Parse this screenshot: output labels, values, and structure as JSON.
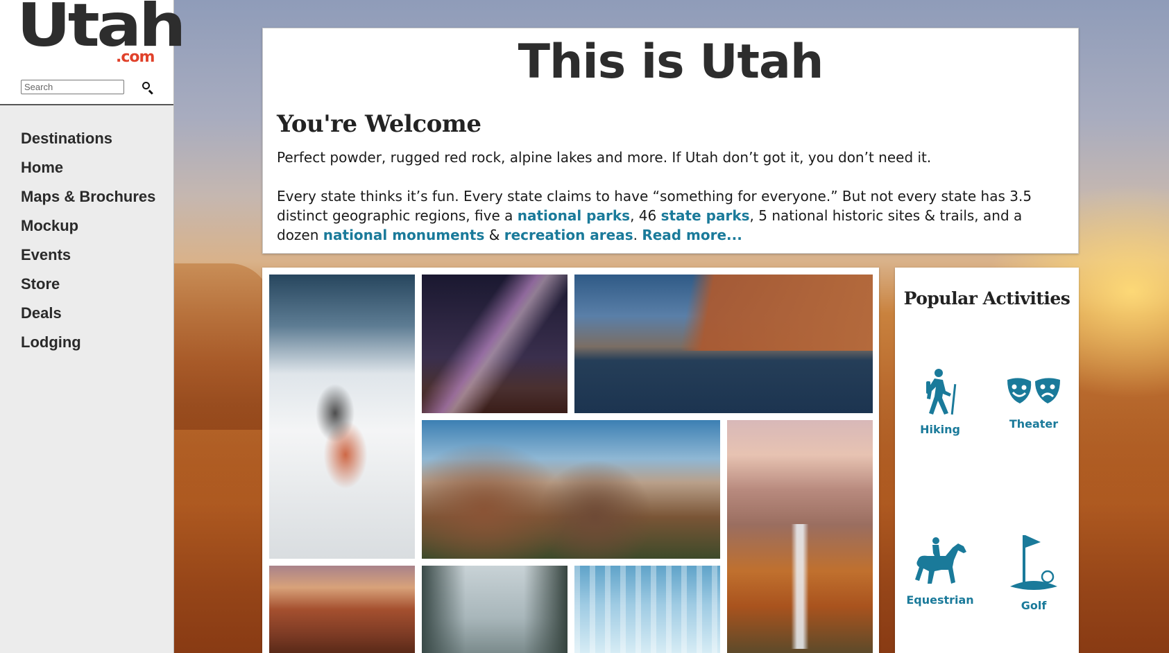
{
  "brand": {
    "logo_main": "Utah",
    "logo_suffix": ".com"
  },
  "search": {
    "placeholder": "Search"
  },
  "nav": {
    "items": [
      {
        "label": "Destinations"
      },
      {
        "label": "Home"
      },
      {
        "label": "Maps & Brochures"
      },
      {
        "label": "Mockup"
      },
      {
        "label": "Events"
      },
      {
        "label": "Store"
      },
      {
        "label": "Deals"
      },
      {
        "label": "Lodging"
      }
    ]
  },
  "intro": {
    "title": "This is Utah",
    "subtitle": "You're Welcome",
    "paragraph1": "Perfect powder, rugged red rock, alpine lakes and more. If Utah don’t got it, you don’t need it.",
    "p2_text1": "Every state thinks it’s fun. Every state claims to have “something for everyone.” But not every state has 3.5 distinct geographic regions, five a ",
    "p2_link1": "national parks",
    "p2_text2": ", 46 ",
    "p2_link2": "state parks",
    "p2_text3": ", 5 national historic sites & trails, and a dozen ",
    "p2_link3": "national monuments",
    "p2_text4": " & ",
    "p2_link4": "recreation areas",
    "p2_text5": ". ",
    "read_more": "Read more..."
  },
  "gallery": {
    "photos": [
      "skier",
      "milky-way-arch",
      "river-canyon",
      "zion-peaks",
      "waterfall",
      "red-canyon-lake",
      "misty-forest",
      "ice-formation"
    ]
  },
  "activities": {
    "title": "Popular Activities",
    "items": [
      {
        "label": "Hiking",
        "icon": "hiking-icon"
      },
      {
        "label": "Theater",
        "icon": "theater-masks-icon"
      },
      {
        "label": "Equestrian",
        "icon": "horse-rider-icon"
      },
      {
        "label": "Golf",
        "icon": "golf-flag-icon"
      }
    ]
  },
  "colors": {
    "accent": "#1a7a9a",
    "logo_red": "#e0412a",
    "text_dark": "#2d2d2d"
  }
}
